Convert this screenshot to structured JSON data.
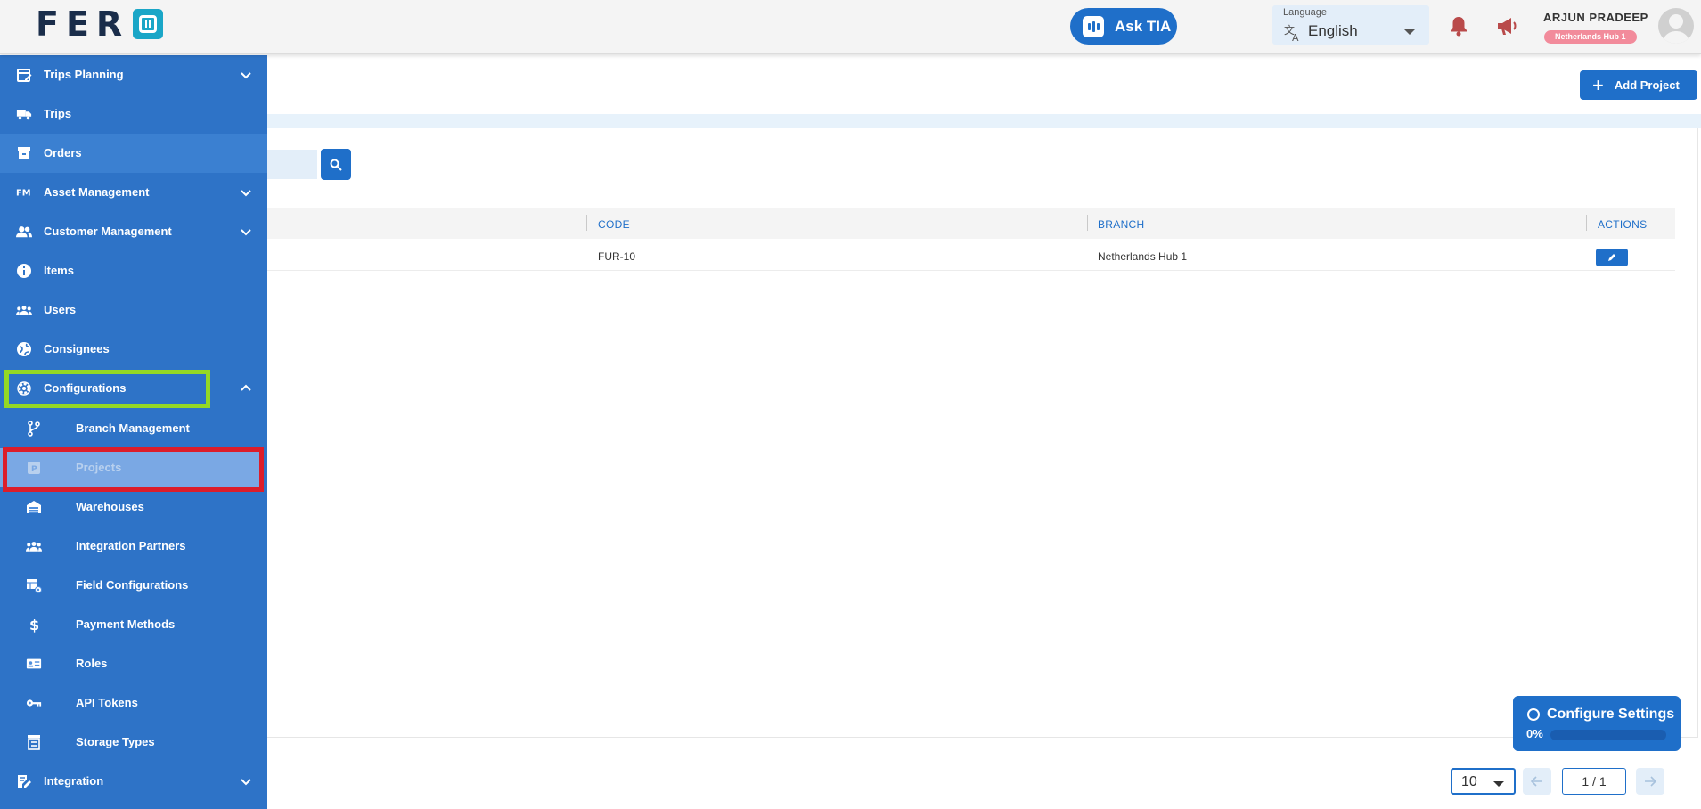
{
  "brand": {
    "logo_text": "FER"
  },
  "header": {
    "ask_tia_label": "Ask TIA",
    "language_label": "Language",
    "language_value": "English",
    "user_name": "ARJUN PRADEEP",
    "user_hub": "Netherlands Hub 1"
  },
  "sidebar": {
    "items": [
      {
        "label": "Trips Planning",
        "icon": "calendar-edit-icon",
        "expandable": true
      },
      {
        "label": "Trips",
        "icon": "truck-icon",
        "expandable": false
      },
      {
        "label": "Orders",
        "icon": "archive-box-icon",
        "expandable": false
      },
      {
        "label": "Asset Management",
        "icon": "fm-icon",
        "expandable": true
      },
      {
        "label": "Customer Management",
        "icon": "people-icon",
        "expandable": true
      },
      {
        "label": "Items",
        "icon": "info-icon",
        "expandable": false
      },
      {
        "label": "Users",
        "icon": "group-icon",
        "expandable": false
      },
      {
        "label": "Consignees",
        "icon": "globe-icon",
        "expandable": false
      },
      {
        "label": "Configurations",
        "icon": "gear-icon",
        "expandable": true,
        "expanded": true
      }
    ],
    "sub_items": [
      {
        "label": "Branch Management",
        "icon": "branch-icon"
      },
      {
        "label": "Projects",
        "icon": "p-badge-icon",
        "selected": true
      },
      {
        "label": "Warehouses",
        "icon": "warehouse-icon"
      },
      {
        "label": "Integration Partners",
        "icon": "group-icon"
      },
      {
        "label": "Field Configurations",
        "icon": "table-gear-icon"
      },
      {
        "label": "Payment Methods",
        "icon": "dollar-icon"
      },
      {
        "label": "Roles",
        "icon": "id-card-icon"
      },
      {
        "label": "API Tokens",
        "icon": "key-icon"
      },
      {
        "label": "Storage Types",
        "icon": "storage-icon"
      }
    ],
    "bottom_item": {
      "label": "Integration",
      "icon": "note-edit-icon",
      "expandable": true
    }
  },
  "main": {
    "add_button_label": "Add Project",
    "table": {
      "columns": [
        "CODE",
        "BRANCH",
        "ACTIONS"
      ],
      "rows": [
        {
          "code": "FUR-10",
          "branch": "Netherlands Hub 1"
        }
      ]
    }
  },
  "configure": {
    "title": "Configure Settings",
    "progress_text": "0%",
    "progress": 0
  },
  "pagination": {
    "page_size": "10",
    "page_indicator": "1 / 1"
  },
  "colors": {
    "primary": "#1f6fc9",
    "sidebar": "#2e73c7",
    "submenu": "#4f8fde",
    "highlight_green": "#94d826",
    "highlight_red": "#dc1d2a",
    "hub_badge": "#f28b9b"
  }
}
